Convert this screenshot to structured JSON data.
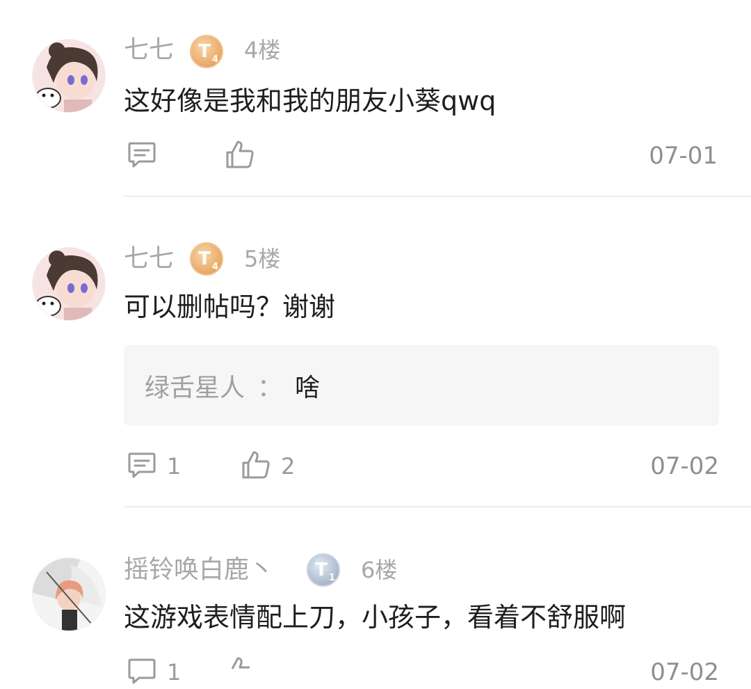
{
  "comments": [
    {
      "user": "七七",
      "badge": {
        "letter": "T",
        "level": "4",
        "tone": "gold"
      },
      "floor": "4楼",
      "text": "这好像是我和我的朋友小葵qwq",
      "reply_count": "",
      "like_count": "",
      "date": "07-01"
    },
    {
      "user": "七七",
      "badge": {
        "letter": "T",
        "level": "4",
        "tone": "gold"
      },
      "floor": "5楼",
      "text": "可以删帖吗？谢谢",
      "sub_reply": {
        "user": "绿舌星人",
        "sep": "：",
        "text": "啥"
      },
      "reply_count": "1",
      "like_count": "2",
      "date": "07-02"
    },
    {
      "user": "摇铃唤白鹿丶",
      "badge": {
        "letter": "T",
        "level": "1",
        "tone": "silver"
      },
      "floor": "6楼",
      "text": "这游戏表情配上刀，小孩子，看着不舒服啊",
      "reply_count": "1",
      "like_count": "",
      "date": "07-02"
    }
  ],
  "icons": {
    "reply": "comment-icon",
    "like": "thumbs-up-icon"
  }
}
